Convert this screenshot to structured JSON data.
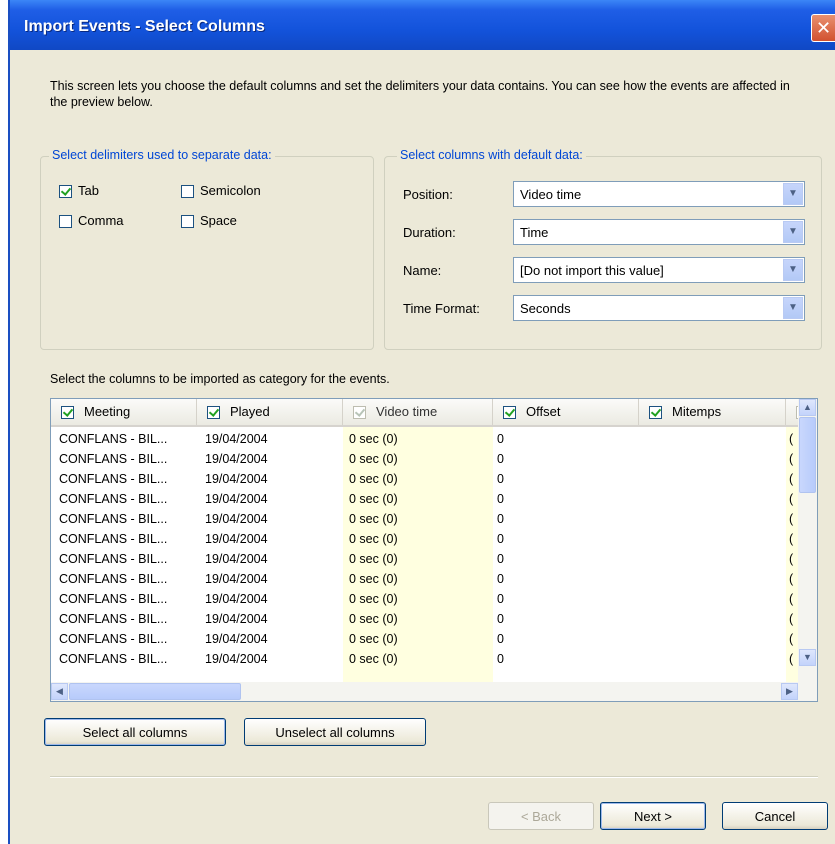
{
  "window": {
    "title": "Import Events - Select Columns",
    "close_glyph": "✕"
  },
  "intro": "This screen lets you choose the default columns and set the delimiters your data contains. You can see how the events are affected in the preview below.",
  "delimiters": {
    "legend": "Select delimiters used to separate data:",
    "options": [
      {
        "label": "Tab",
        "checked": true
      },
      {
        "label": "Semicolon",
        "checked": false
      },
      {
        "label": "Comma",
        "checked": false
      },
      {
        "label": "Space",
        "checked": false
      }
    ]
  },
  "defaults": {
    "legend": "Select columns with default data:",
    "fields": [
      {
        "label": "Position:",
        "value": "Video time"
      },
      {
        "label": "Duration:",
        "value": "Time"
      },
      {
        "label": "Name:",
        "value": "[Do not import this value]"
      },
      {
        "label": "Time Format:",
        "value": "Seconds"
      }
    ]
  },
  "category_label": "Select the columns to be imported as category for the events.",
  "list": {
    "columns": [
      {
        "label": "Meeting",
        "checked": true
      },
      {
        "label": "Played",
        "checked": true
      },
      {
        "label": "Video time",
        "checked": true,
        "disabled": true
      },
      {
        "label": "Offset",
        "checked": true
      },
      {
        "label": "Mitemps",
        "checked": true
      }
    ],
    "rows": [
      [
        "CONFLANS - BIL...",
        "19/04/2004",
        "0 sec (0)",
        "0",
        "",
        "("
      ],
      [
        "CONFLANS - BIL...",
        "19/04/2004",
        "0 sec (0)",
        "0",
        "",
        "("
      ],
      [
        "CONFLANS - BIL...",
        "19/04/2004",
        "0 sec (0)",
        "0",
        "",
        "("
      ],
      [
        "CONFLANS - BIL...",
        "19/04/2004",
        "0 sec (0)",
        "0",
        "",
        "("
      ],
      [
        "CONFLANS - BIL...",
        "19/04/2004",
        "0 sec (0)",
        "0",
        "",
        "("
      ],
      [
        "CONFLANS - BIL...",
        "19/04/2004",
        "0 sec (0)",
        "0",
        "",
        "("
      ],
      [
        "CONFLANS - BIL...",
        "19/04/2004",
        "0 sec (0)",
        "0",
        "",
        "("
      ],
      [
        "CONFLANS - BIL...",
        "19/04/2004",
        "0 sec (0)",
        "0",
        "",
        "("
      ],
      [
        "CONFLANS - BIL...",
        "19/04/2004",
        "0 sec (0)",
        "0",
        "",
        "("
      ],
      [
        "CONFLANS - BIL...",
        "19/04/2004",
        "0 sec (0)",
        "0",
        "",
        "("
      ],
      [
        "CONFLANS - BIL...",
        "19/04/2004",
        "0 sec (0)",
        "0",
        "",
        "("
      ],
      [
        "CONFLANS - BIL...",
        "19/04/2004",
        "0 sec (0)",
        "0",
        "",
        "("
      ]
    ]
  },
  "buttons": {
    "select_all": "Select all columns",
    "unselect_all": "Unselect all columns",
    "back": "< Back",
    "next": "Next >",
    "cancel": "Cancel"
  },
  "icons": {
    "dropdown": "chevron-down-icon",
    "scroll_up": "arrow-up-icon",
    "scroll_down": "arrow-down-icon",
    "scroll_left": "arrow-left-icon",
    "scroll_right": "arrow-right-icon"
  },
  "colors": {
    "titlebar": "#1353db",
    "legend_text": "#0046d5",
    "dialog_bg": "#ece9d8",
    "highlight_column": "#ffffe0",
    "close_button": "#d2512f"
  }
}
